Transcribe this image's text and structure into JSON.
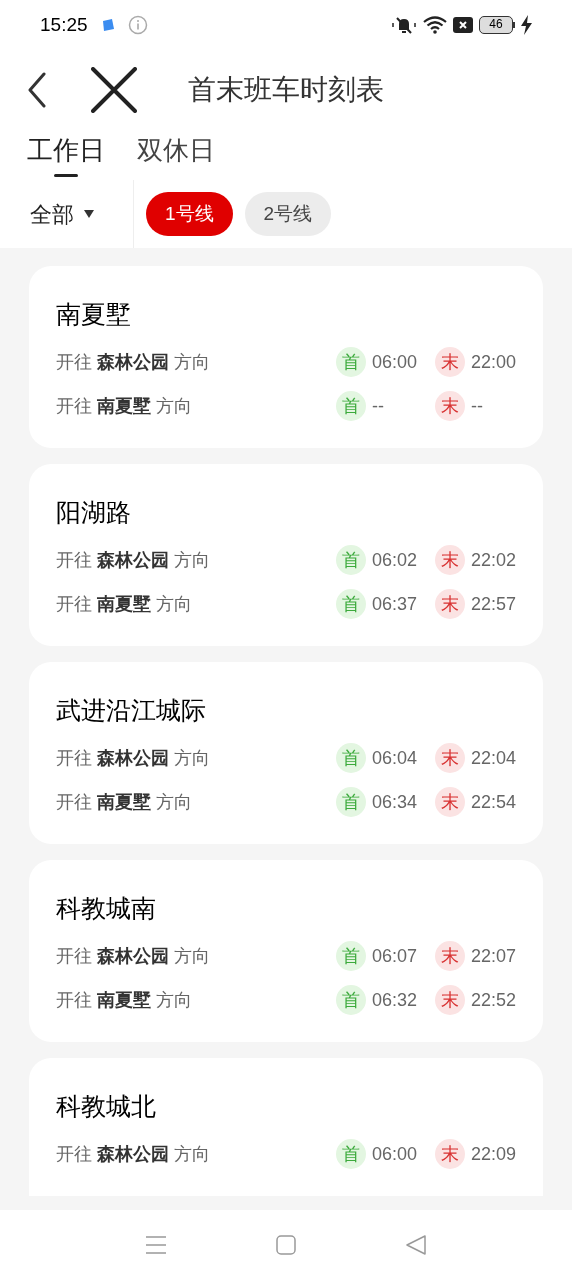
{
  "status_bar": {
    "time": "15:25",
    "battery": "46"
  },
  "header": {
    "title": "首末班车时刻表"
  },
  "tabs": [
    {
      "label": "工作日",
      "selected": true
    },
    {
      "label": "双休日",
      "selected": false
    }
  ],
  "filter": {
    "dropdown": "全部",
    "lines": [
      {
        "label": "1号线",
        "selected": true
      },
      {
        "label": "2号线",
        "selected": false
      }
    ]
  },
  "stations": [
    {
      "name": "南夏墅",
      "rows": [
        {
          "direction": "开往 **森林公园** 方向",
          "first_label": "首",
          "first": "06:00",
          "last_label": "末",
          "last": "22:00"
        },
        {
          "direction": "开往 **南夏墅** 方向",
          "first_label": "首",
          "first": "--",
          "last_label": "末",
          "last": "--"
        }
      ]
    },
    {
      "name": "阳湖路",
      "rows": [
        {
          "direction": "开往 **森林公园** 方向",
          "first_label": "首",
          "first": "06:02",
          "last_label": "末",
          "last": "22:02"
        },
        {
          "direction": "开往 **南夏墅** 方向",
          "first_label": "首",
          "first": "06:37",
          "last_label": "末",
          "last": "22:57"
        }
      ]
    },
    {
      "name": "武进沿江城际",
      "rows": [
        {
          "direction": "开往 **森林公园** 方向",
          "first_label": "首",
          "first": "06:04",
          "last_label": "末",
          "last": "22:04"
        },
        {
          "direction": "开往 **南夏墅** 方向",
          "first_label": "首",
          "first": "06:34",
          "last_label": "末",
          "last": "22:54"
        }
      ]
    },
    {
      "name": "科教城南",
      "rows": [
        {
          "direction": "开往 **森林公园** 方向",
          "first_label": "首",
          "first": "06:07",
          "last_label": "末",
          "last": "22:07"
        },
        {
          "direction": "开往 **南夏墅** 方向",
          "first_label": "首",
          "first": "06:32",
          "last_label": "末",
          "last": "22:52"
        }
      ]
    },
    {
      "name": "科教城北",
      "rows": [
        {
          "direction": "开往 **森林公园** 方向",
          "first_label": "首",
          "first": "06:00",
          "last_label": "末",
          "last": "22:09"
        }
      ]
    }
  ]
}
